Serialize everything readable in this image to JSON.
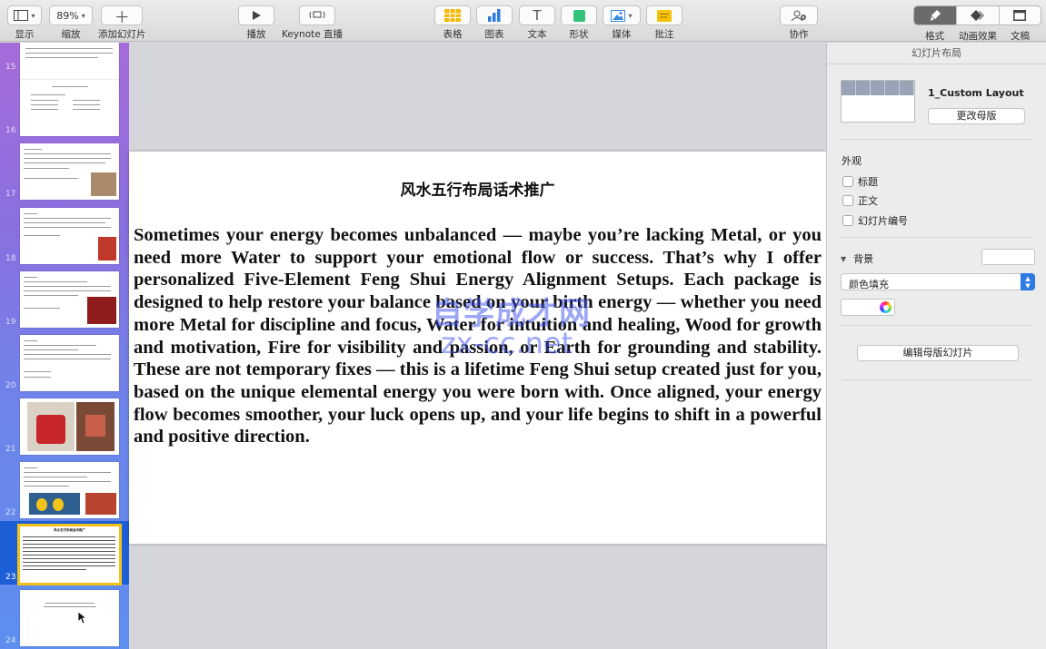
{
  "toolbar": {
    "view_label": "显示",
    "zoom_value": "89%",
    "zoom_label": "缩放",
    "add_slide_label": "添加幻灯片",
    "play_label": "播放",
    "keynote_live_label": "Keynote 直播",
    "table_label": "表格",
    "chart_label": "图表",
    "text_label": "文本",
    "shape_label": "形状",
    "media_label": "媒体",
    "comment_label": "批注",
    "collaborate_label": "协作",
    "format_label": "格式",
    "animate_label": "动画效果",
    "document_label": "文稿"
  },
  "navigator": {
    "slide_numbers": [
      "15",
      "16",
      "17",
      "18",
      "19",
      "20",
      "21",
      "22",
      "23",
      "24"
    ],
    "selected_number": "23",
    "selected_title": "风水五行布局话术推广"
  },
  "slide": {
    "title": "风水五行布局话术推广",
    "body": "Sometimes your energy becomes unbalanced — maybe you’re lacking Metal, or you need more Water to support your emotional flow or success. That’s why I offer personalized Five-Element Feng Shui Energy Alignment Setups. Each package is designed to help restore your balance based on your birth energy — whether you need more Metal for discipline and focus, Water for intuition and healing, Wood for growth and motivation, Fire for visibility and passion, or Earth for grounding and stability. These are not temporary fixes — this is a lifetime Feng Shui setup created just for you, based on the unique elemental energy you were born with. Once aligned, your energy flow becomes smoother, your luck opens up, and your life begins to shift in a powerful and positive direction.",
    "watermark_line1": "自学成才网",
    "watermark_line2": "zx-cc.net"
  },
  "inspector": {
    "header": "幻灯片布局",
    "layout_name": "1_Custom Layout",
    "change_master_button": "更改母版",
    "appearance_heading": "外观",
    "title_checkbox": "标题",
    "body_checkbox": "正文",
    "slide_number_checkbox": "幻灯片编号",
    "background_heading": "背景",
    "fill_type": "颜色填充",
    "edit_master_button": "编辑母版幻灯片"
  },
  "colors": {
    "selection": "#1d5fd6",
    "thumb_highlight": "#f2c21b",
    "watermark": "#3c50eb"
  }
}
